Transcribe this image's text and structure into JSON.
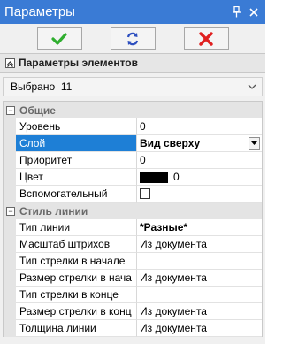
{
  "window": {
    "title": "Параметры"
  },
  "toolbar": {
    "ok_icon": "check-icon",
    "refresh_icon": "refresh-icon",
    "cancel_icon": "close-icon",
    "ok_color": "#2fae2f",
    "refresh_color": "#2d4fbf",
    "cancel_color": "#e02020"
  },
  "elements_section": {
    "title": "Параметры элементов"
  },
  "selection": {
    "label": "Выбрано",
    "count": "11"
  },
  "groups": {
    "general": {
      "title": "Общие",
      "props": {
        "level": {
          "name": "Уровень",
          "value": "0"
        },
        "layer": {
          "name": "Слой",
          "value": "Вид сверху"
        },
        "priority": {
          "name": "Приоритет",
          "value": "0"
        },
        "color": {
          "name": "Цвет",
          "value": "0",
          "swatch": "#000000"
        },
        "auxiliary": {
          "name": "Вспомогательный",
          "checked": false
        }
      }
    },
    "line_style": {
      "title": "Стиль линии",
      "props": {
        "line_type": {
          "name": "Тип линии",
          "value": "*Разные*"
        },
        "dash_scale": {
          "name": "Масштаб штрихов",
          "value": "Из документа"
        },
        "arrow_start_type": {
          "name": "Тип стрелки в начале",
          "value": ""
        },
        "arrow_start_size": {
          "name": "Размер стрелки в нача",
          "value": "Из документа"
        },
        "arrow_end_type": {
          "name": "Тип стрелки в конце",
          "value": ""
        },
        "arrow_end_size": {
          "name": "Размер стрелки в конц",
          "value": "Из документа"
        },
        "line_width": {
          "name": "Толщина линии",
          "value": "Из документа"
        }
      }
    }
  },
  "accent_color": "#3a7bd5",
  "selection_color": "#1e7fd6"
}
